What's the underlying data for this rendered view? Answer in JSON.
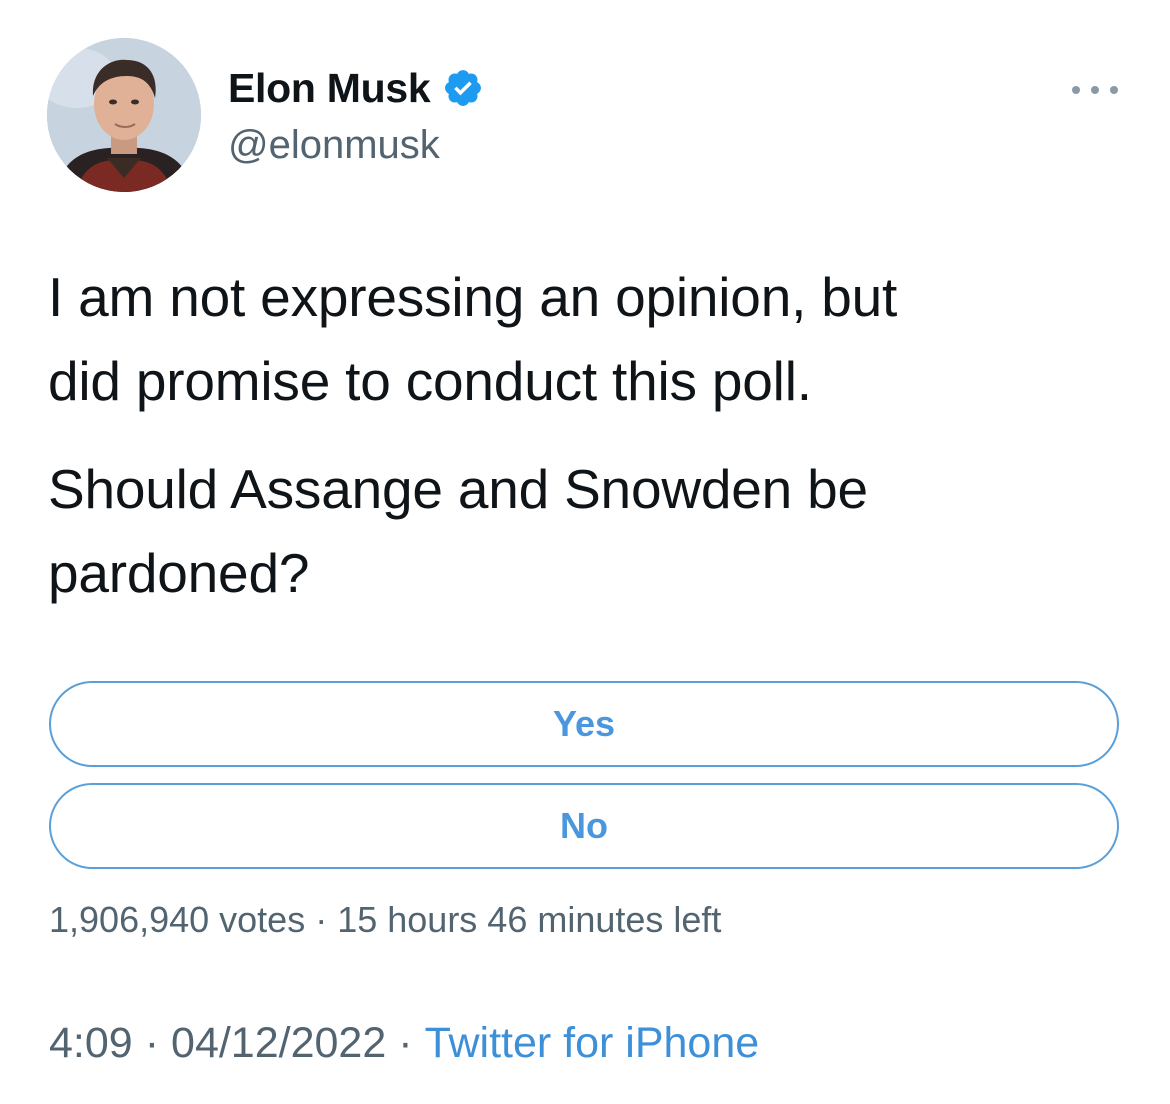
{
  "tweet": {
    "author": {
      "display_name": "Elon Musk",
      "handle": "@elonmusk",
      "verified_icon": "verified-badge-icon",
      "avatar": "profile-photo"
    },
    "more_icon": "more-dots-icon",
    "text": {
      "paragraph_1": "I am not expressing an opinion, but\ndid promise to conduct this poll.",
      "paragraph_2": "Should Assange and Snowden be\npardoned?"
    },
    "poll": {
      "options": [
        {
          "label": "Yes"
        },
        {
          "label": "No"
        }
      ],
      "votes": "1,906,940 votes",
      "separator": "·",
      "time_left": "15 hours 46 minutes left"
    },
    "footer": {
      "time": "4:09",
      "separator": "·",
      "date": "04/12/2022",
      "source": "Twitter for iPhone"
    }
  },
  "colors": {
    "text_primary": "#0f1419",
    "text_secondary": "#536471",
    "accent_blue": "#4a97de",
    "poll_border": "#5a9fd8",
    "verified_blue": "#1d9bf0"
  }
}
